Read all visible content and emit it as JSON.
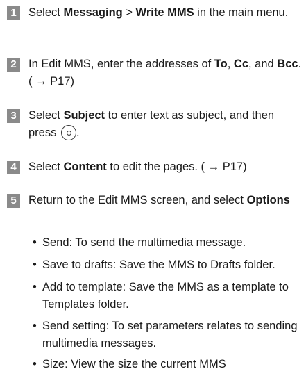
{
  "steps": [
    {
      "number": "1",
      "parts": [
        {
          "t": "Select ",
          "b": false
        },
        {
          "t": "Messaging",
          "b": true
        },
        {
          "t": " > ",
          "b": false
        },
        {
          "t": "Write MMS",
          "b": true
        },
        {
          "t": " in the main menu.",
          "b": false
        }
      ]
    },
    {
      "number": "2",
      "parts": [
        {
          "t": "In Edit MMS, enter the addresses of ",
          "b": false
        },
        {
          "t": "To",
          "b": true
        },
        {
          "t": ", ",
          "b": false
        },
        {
          "t": "Cc",
          "b": true
        },
        {
          "t": ", and ",
          "b": false
        },
        {
          "t": "Bcc",
          "b": true
        },
        {
          "t": ".( → P17)",
          "b": false
        }
      ]
    },
    {
      "number": "3",
      "parts": [
        {
          "t": "Select ",
          "b": false
        },
        {
          "t": "Subject",
          "b": true
        },
        {
          "t": " to enter text as subject, and then press ",
          "b": false
        },
        {
          "icon": "select-key-icon"
        },
        {
          "t": ".",
          "b": false
        }
      ]
    },
    {
      "number": "4",
      "parts": [
        {
          "t": "Select ",
          "b": false
        },
        {
          "t": "Content",
          "b": true
        },
        {
          "t": " to edit the pages. ( → P17)",
          "b": false
        }
      ]
    },
    {
      "number": "5",
      "parts": [
        {
          "t": "Return to the Edit MMS screen, and select ",
          "b": false
        },
        {
          "t": "Options",
          "b": true
        }
      ]
    }
  ],
  "options": [
    {
      "bullet": "•",
      "text": "Send: To send the multimedia message."
    },
    {
      "bullet": "•",
      "text": "Save to drafts: Save the MMS to Drafts folder."
    },
    {
      "bullet": "•",
      "text": "Add to template: Save the MMS as a template to Templates folder."
    },
    {
      "bullet": "•",
      "text": "Send setting: To set parameters relates to sending multimedia messages."
    },
    {
      "bullet": "•",
      "text": "Size: View the size the current MMS"
    }
  ],
  "colors": {
    "badge_bg": "#8a8a8a",
    "badge_text": "#ffffff",
    "text": "#1a1a1a"
  }
}
